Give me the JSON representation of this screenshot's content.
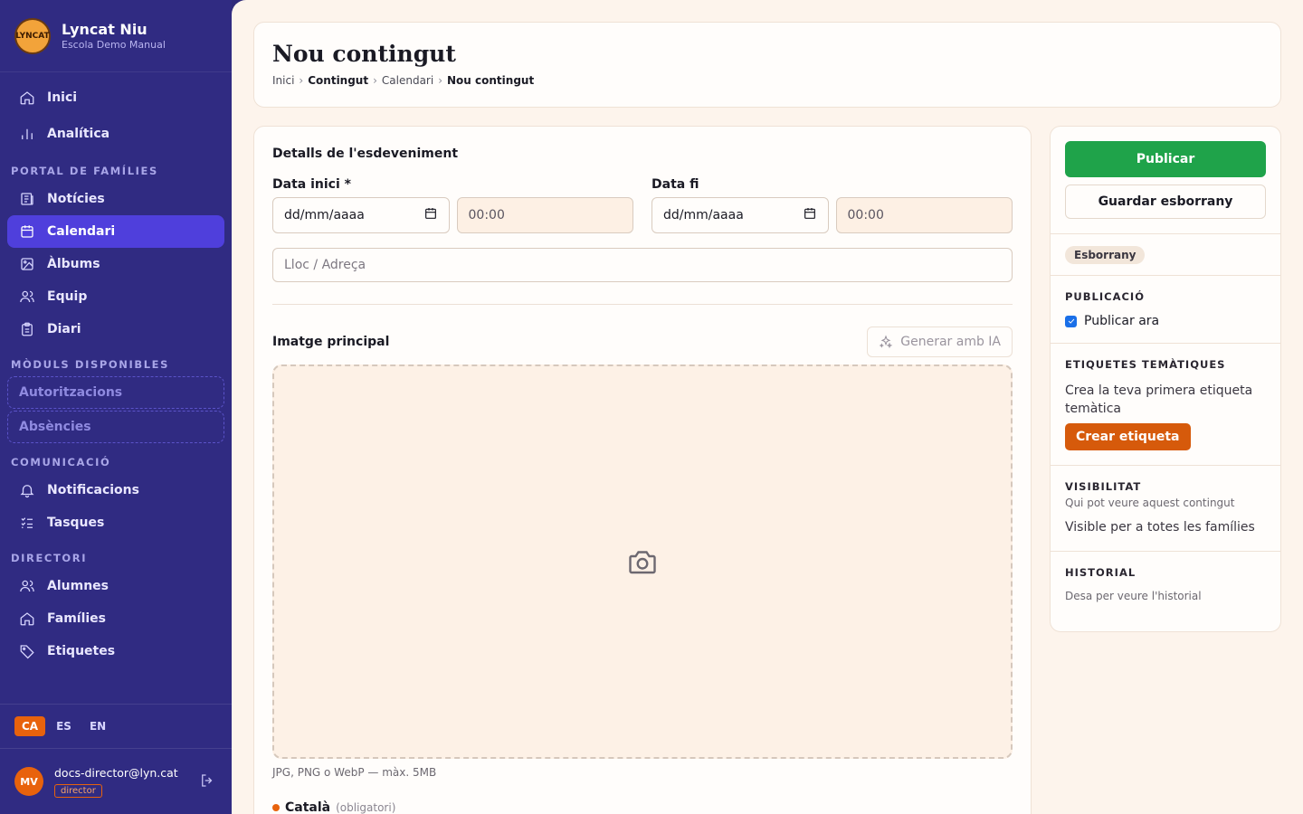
{
  "app": {
    "name": "Lyncat Niu",
    "school": "Escola Demo Manual",
    "logo_text": "LYNCAT"
  },
  "nav": {
    "main": [
      {
        "label": "Inici",
        "icon": "home-icon"
      },
      {
        "label": "Analítica",
        "icon": "bar-chart-icon"
      }
    ],
    "portal_label": "PORTAL DE FAMÍLIES",
    "portal": [
      {
        "label": "Notícies",
        "icon": "newspaper-icon"
      },
      {
        "label": "Calendari",
        "icon": "calendar-icon",
        "active": true
      },
      {
        "label": "Àlbums",
        "icon": "image-icon"
      },
      {
        "label": "Equip",
        "icon": "users-icon"
      },
      {
        "label": "Diari",
        "icon": "clipboard-icon"
      }
    ],
    "modules_label": "MÒDULS DISPONIBLES",
    "modules": [
      {
        "label": "Autoritzacions"
      },
      {
        "label": "Absències"
      }
    ],
    "comm_label": "COMUNICACIÓ",
    "comm": [
      {
        "label": "Notificacions",
        "icon": "bell-icon"
      },
      {
        "label": "Tasques",
        "icon": "list-check-icon"
      }
    ],
    "director_label": "DIRECTORI",
    "director": [
      {
        "label": "Alumnes",
        "icon": "users-icon"
      },
      {
        "label": "Famílies",
        "icon": "home-icon"
      },
      {
        "label": "Etiquetes",
        "icon": "tag-icon"
      }
    ]
  },
  "languages": [
    {
      "code": "CA",
      "active": true
    },
    {
      "code": "ES"
    },
    {
      "code": "EN"
    }
  ],
  "user": {
    "initials": "MV",
    "email": "docs-director@lyn.cat",
    "role": "director"
  },
  "header": {
    "title": "Nou contingut",
    "breadcrumb": [
      "Inici",
      "Contingut",
      "Calendari",
      "Nou contingut"
    ],
    "breadcrumb_sep": "›"
  },
  "form": {
    "section_title": "Detalls de l'esdeveniment",
    "start_label": "Data inici *",
    "end_label": "Data fi",
    "date_placeholder": "dd/mm/aaaa",
    "time_placeholder": "00:00",
    "location_placeholder": "Lloc / Adreça",
    "image_label": "Imatge principal",
    "ai_button": "Generar amb IA",
    "image_hint": "JPG, PNG o WebP — màx. 5MB",
    "language_label": "Català",
    "language_req": "(obligatori)"
  },
  "sidebar_right": {
    "publish": "Publicar",
    "save_draft": "Guardar esborrany",
    "status": "Esborrany",
    "publication_title": "PUBLICACIÓ",
    "publish_now": "Publicar ara",
    "publish_now_checked": true,
    "tags_title": "ETIQUETES TEMÀTIQUES",
    "tags_empty": "Crea la teva primera etiqueta temàtica",
    "create_tag": "Crear etiqueta",
    "visibility_title": "VISIBILITAT",
    "visibility_sub": "Qui pot veure aquest contingut",
    "visibility_value": "Visible per a totes les famílies",
    "history_title": "HISTORIAL",
    "history_text": "Desa per veure l'historial"
  },
  "colors": {
    "sidebar": "#302b82",
    "active": "#4f3fdc",
    "accent": "#e8620c",
    "publish": "#1fa34a",
    "background": "#fdf4ec"
  }
}
